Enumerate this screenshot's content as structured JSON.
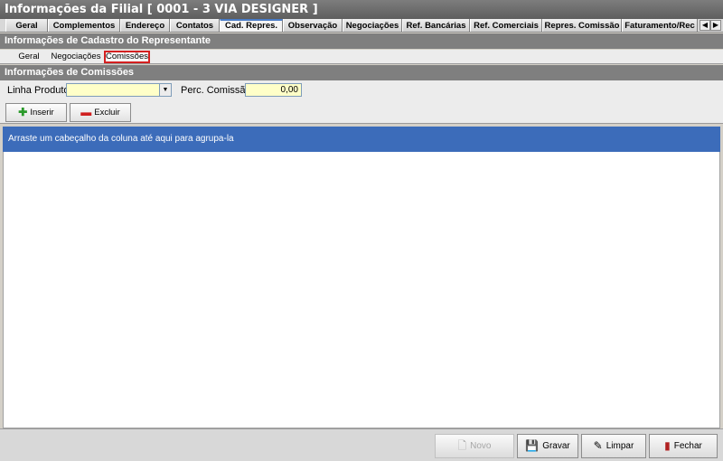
{
  "window": {
    "title": "Informações da Filial [ 0001 - 3 VIA DESIGNER ]"
  },
  "top_tabs": [
    {
      "label": "Geral"
    },
    {
      "label": "Complementos"
    },
    {
      "label": "Endereço"
    },
    {
      "label": "Contatos"
    },
    {
      "label": "Cad. Repres.",
      "active": true
    },
    {
      "label": "Observação"
    },
    {
      "label": "Negociações"
    },
    {
      "label": "Ref. Bancárias"
    },
    {
      "label": "Ref. Comerciais"
    },
    {
      "label": "Repres. Comissão"
    },
    {
      "label": "Faturamento/Rec"
    }
  ],
  "tab_scroll": {
    "left": "◀",
    "right": "▶"
  },
  "section_representante": "Informações de Cadastro do Representante",
  "sub_tabs": [
    {
      "label": "Geral"
    },
    {
      "label": "Negociações"
    },
    {
      "label": "Comissões",
      "active": true
    }
  ],
  "section_comissoes": "Informações de Comissões",
  "form": {
    "linha_produto_label": "Linha Produto",
    "linha_produto_value": "",
    "combo_arrow": "▼",
    "perc_comissao_label": "Perc. Comissão",
    "perc_comissao_value": "0,00"
  },
  "grid_toolbar": {
    "insert_label": "Inserir",
    "insert_icon": "✚",
    "delete_label": "Excluir",
    "delete_icon": "▬"
  },
  "grid": {
    "group_hint": "Arraste um cabeçalho da coluna até aqui para agrupa-la"
  },
  "footer": {
    "novo": {
      "label": "Novo",
      "icon": "🗋",
      "enabled": false
    },
    "gravar": {
      "label": "Gravar",
      "icon": "💾"
    },
    "limpar": {
      "label": "Limpar",
      "icon": "✎"
    },
    "fechar": {
      "label": "Fechar",
      "icon": "▮"
    }
  },
  "colors": {
    "group_panel": "#3c6cba",
    "input_bg": "#ffffc8",
    "section_bar": "#7f7f7f",
    "active_subtab_border": "#d42020"
  }
}
